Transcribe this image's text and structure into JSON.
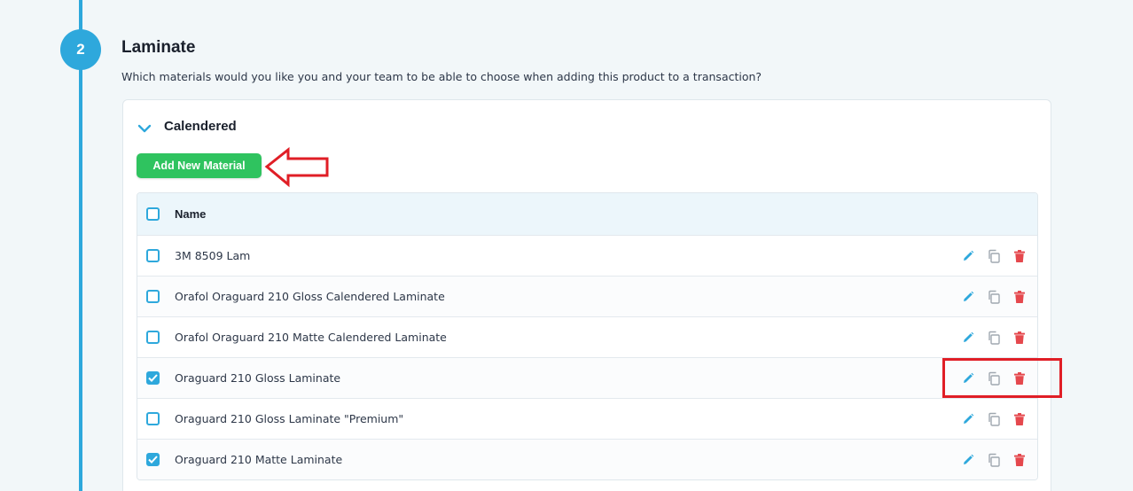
{
  "step": {
    "number": "2",
    "title": "Laminate",
    "description": "Which materials would you like you and your team to be able to choose when adding this product to a transaction?"
  },
  "group": {
    "title": "Calendered",
    "add_button_label": "Add New Material"
  },
  "table": {
    "header_name": "Name",
    "rows": [
      {
        "name": "3M 8509 Lam",
        "checked": false
      },
      {
        "name": "Orafol Oraguard 210 Gloss Calendered Laminate",
        "checked": false
      },
      {
        "name": "Orafol Oraguard 210 Matte Calendered Laminate",
        "checked": false
      },
      {
        "name": "Oraguard 210 Gloss Laminate",
        "checked": true
      },
      {
        "name": "Oraguard 210 Gloss Laminate \"Premium\"",
        "checked": false
      },
      {
        "name": "Oraguard 210 Matte Laminate",
        "checked": true
      }
    ]
  },
  "icons": {
    "step_line": "step-line",
    "chevron": "chevron-down-icon",
    "edit": "pencil-icon",
    "duplicate": "copy-icon",
    "delete": "trash-icon"
  },
  "colors": {
    "accent": "#2ea8dc",
    "add_button": "#2fc35f",
    "delete": "#e5484d",
    "annotation": "#e01e26"
  }
}
